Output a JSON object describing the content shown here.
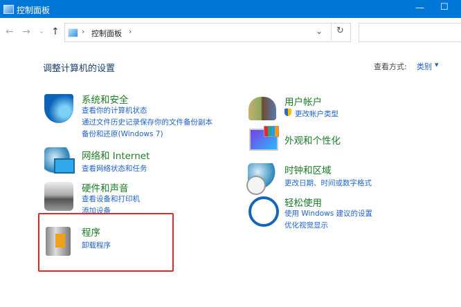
{
  "window": {
    "title": "控制面板",
    "minimize": "—",
    "maximize": "☐"
  },
  "nav": {
    "back": "←",
    "forward": "→",
    "recent": "⌄",
    "up": "↑",
    "refresh": "↻",
    "dropdown": "⌄"
  },
  "address": {
    "sep1": "›",
    "crumb": "控制面板",
    "sep2": "›"
  },
  "main": {
    "heading": "调整计算机的设置",
    "view_by_label": "查看方式:",
    "view_by_value": "类别",
    "view_by_arrow": "▾"
  },
  "left": [
    {
      "title": "系统和安全",
      "links": [
        "查看你的计算机状态",
        "通过文件历史记录保存你的文件备份副本",
        "备份和还原(Windows 7)"
      ]
    },
    {
      "title": "网络和 Internet",
      "links": [
        "查看网络状态和任务"
      ]
    },
    {
      "title": "硬件和声音",
      "links": [
        "查看设备和打印机",
        "添加设备"
      ]
    },
    {
      "title": "程序",
      "links": [
        "卸载程序"
      ]
    }
  ],
  "right": [
    {
      "title": "用户帐户",
      "links": [
        "更改帐户类型"
      ]
    },
    {
      "title": "外观和个性化",
      "links": []
    },
    {
      "title": "时钟和区域",
      "links": [
        "更改日期、时间或数字格式"
      ]
    },
    {
      "title": "轻松使用",
      "links": [
        "使用 Windows 建议的设置",
        "优化视觉显示"
      ]
    }
  ],
  "colors": {
    "titlebar": "#0078d7",
    "category": "#1e7b2a",
    "link": "#1f63c6",
    "highlight": "#e8262a"
  }
}
